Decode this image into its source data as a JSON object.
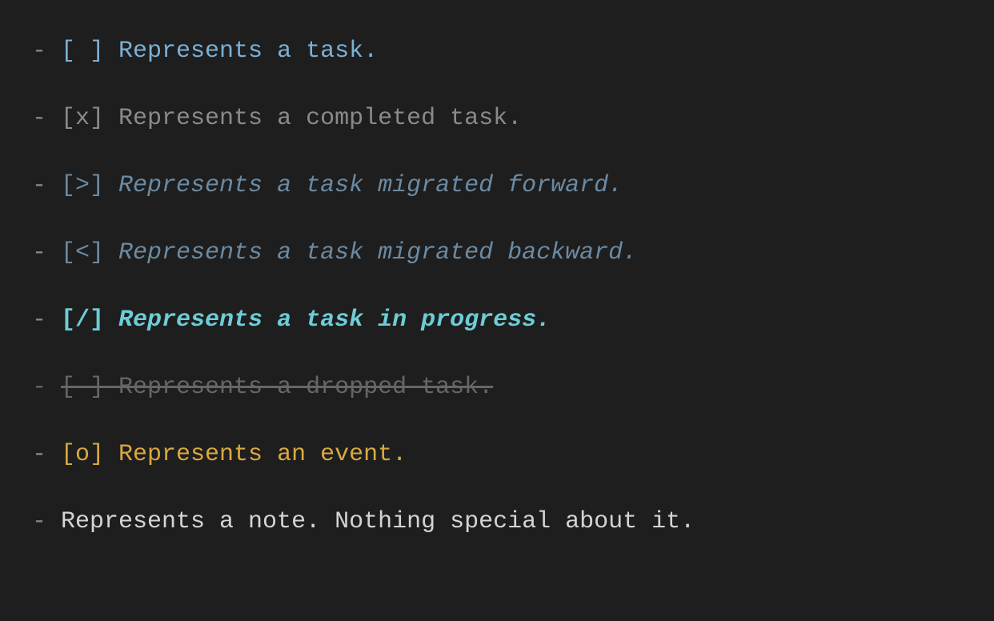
{
  "lines": [
    {
      "dash": "- ",
      "bracket": "[ ] ",
      "text": "Represents a task.",
      "dashClass": "dash",
      "bracketClass": "bracket-task",
      "textClass": "text-task",
      "name": "task-open"
    },
    {
      "dash": "- ",
      "bracket": "[x] ",
      "text": "Represents a completed task.",
      "dashClass": "dash",
      "bracketClass": "bracket-completed",
      "textClass": "text-completed",
      "name": "task-completed"
    },
    {
      "dash": "- ",
      "bracket": "[>] ",
      "text": "Represents a task migrated forward.",
      "dashClass": "dash",
      "bracketClass": "bracket-migrated",
      "textClass": "text-migrated",
      "name": "task-migrated-forward"
    },
    {
      "dash": "- ",
      "bracket": "[<] ",
      "text": "Represents a task migrated backward.",
      "dashClass": "dash",
      "bracketClass": "bracket-migrated",
      "textClass": "text-migrated",
      "name": "task-migrated-backward"
    },
    {
      "dash": "- ",
      "bracket": "[/] ",
      "text": "Represents a task in progress.",
      "dashClass": "dash",
      "bracketClass": "bracket-progress",
      "textClass": "text-progress",
      "name": "task-in-progress"
    },
    {
      "dash": "- ",
      "bracket": "[-] ",
      "text": "Represents a dropped task.",
      "dashClass": "dash-dropped",
      "bracketClass": "bracket-dropped",
      "textClass": "text-dropped",
      "name": "task-dropped"
    },
    {
      "dash": "- ",
      "bracket": "[o] ",
      "text": "Represents an event.",
      "dashClass": "dash",
      "bracketClass": "bracket-event",
      "textClass": "text-event",
      "name": "task-event"
    },
    {
      "dash": "- ",
      "bracket": "",
      "text": "Represents a note. Nothing special about it.",
      "dashClass": "dash",
      "bracketClass": "",
      "textClass": "text-note",
      "name": "task-note"
    }
  ]
}
